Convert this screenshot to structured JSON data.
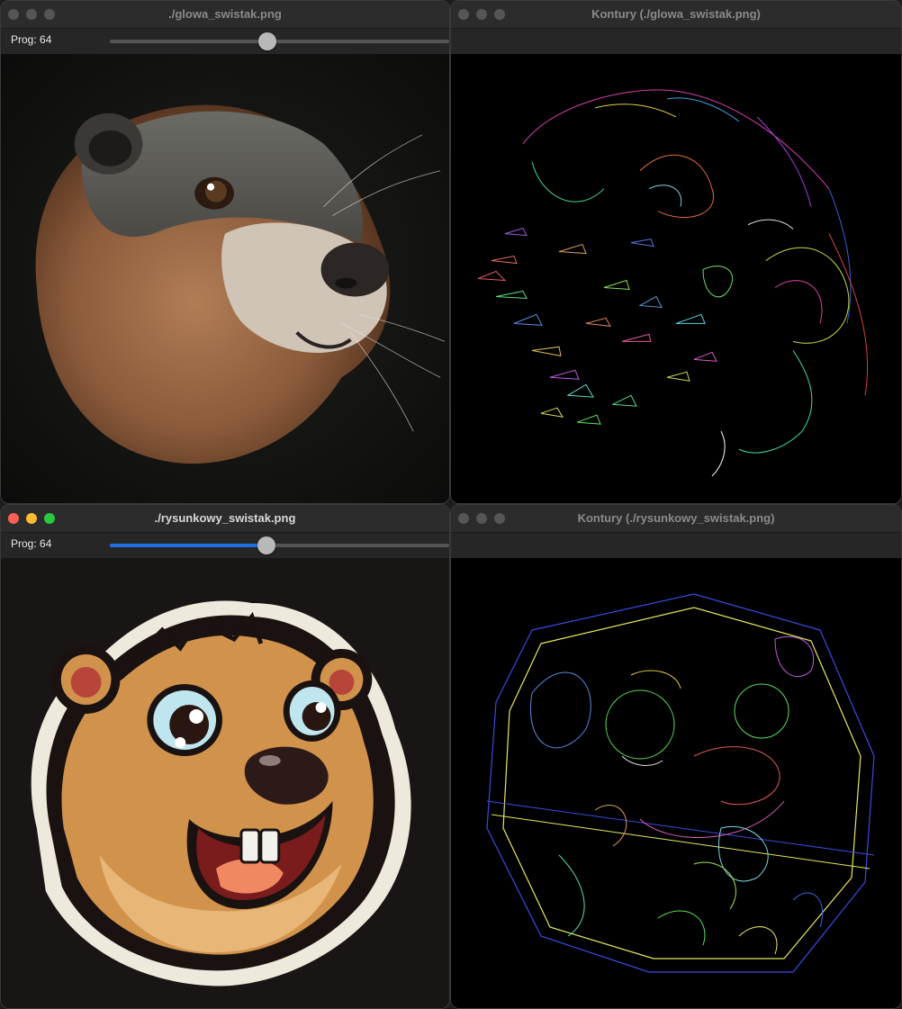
{
  "windows": [
    {
      "title": "./glowa_swistak.png",
      "slider_label": "Prog: 64",
      "slider_value": 64,
      "slider_fraction": 0.46,
      "active": false,
      "image": "photorealistic marmot head"
    },
    {
      "title": "Kontury (./glowa_swistak.png)",
      "active": false,
      "image": "colored contour lines of marmot photo"
    },
    {
      "title": "./rysunkowy_swistak.png",
      "slider_label": "Prog: 64",
      "slider_value": 64,
      "slider_fraction": 0.46,
      "active": true,
      "image": "cartoon marmot head"
    },
    {
      "title": "Kontury (./rysunkowy_swistak.png)",
      "active": false,
      "image": "colored contour lines of cartoon marmot"
    }
  ],
  "colors": {
    "slider_accent": "#1f6fe0",
    "traffic_red": "#ff5f57",
    "traffic_yellow": "#febc2e",
    "traffic_green": "#28c840"
  }
}
